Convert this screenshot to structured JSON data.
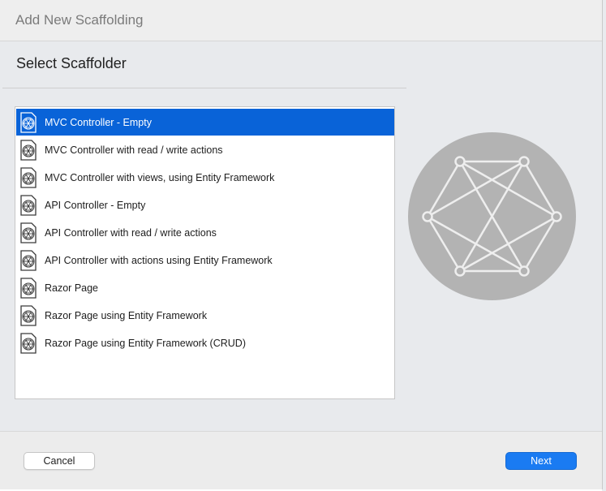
{
  "dialog": {
    "title": "Add New Scaffolding",
    "heading": "Select Scaffolder"
  },
  "scaffolders": [
    {
      "label": "MVC Controller - Empty",
      "selected": true
    },
    {
      "label": "MVC Controller with read / write actions",
      "selected": false
    },
    {
      "label": "MVC Controller with views, using Entity Framework",
      "selected": false
    },
    {
      "label": "API Controller - Empty",
      "selected": false
    },
    {
      "label": "API Controller with read / write actions",
      "selected": false
    },
    {
      "label": "API Controller with actions using Entity Framework",
      "selected": false
    },
    {
      "label": "Razor Page",
      "selected": false
    },
    {
      "label": "Razor Page using Entity Framework",
      "selected": false
    },
    {
      "label": "Razor Page using Entity Framework (CRUD)",
      "selected": false
    }
  ],
  "buttons": {
    "cancel_label": "Cancel",
    "next_label": "Next"
  },
  "preview": {
    "icon": "scaffold-network-icon"
  },
  "colors": {
    "selection": "#0963d8",
    "primary_button": "#1a7bf2",
    "preview_circle": "#b3b3b3"
  }
}
